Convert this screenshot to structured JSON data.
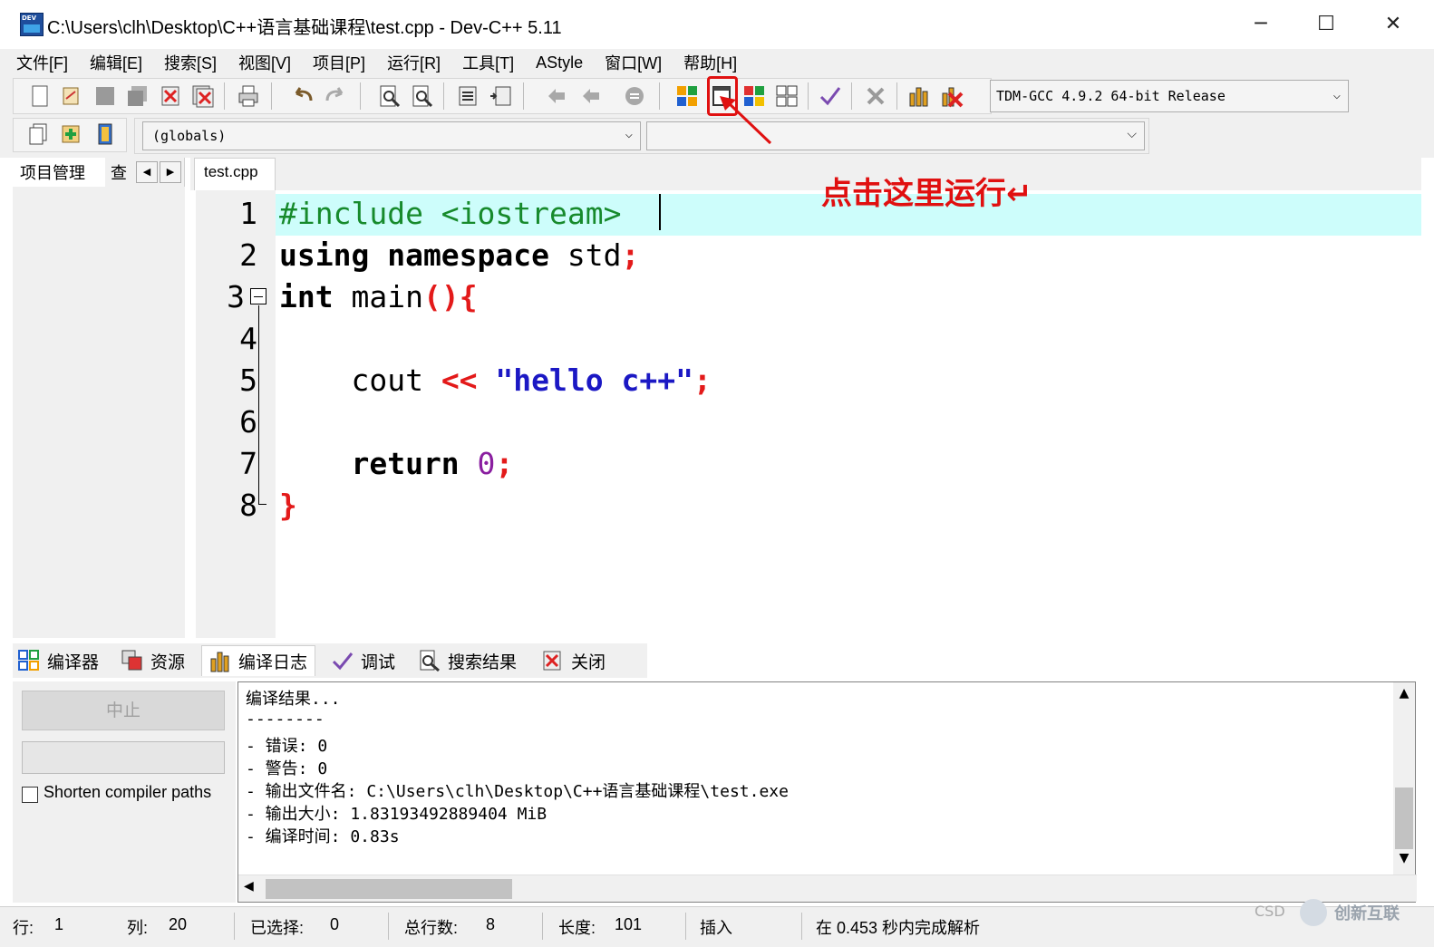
{
  "window": {
    "title": "C:\\Users\\clh\\Desktop\\C++语言基础课程\\test.cpp - Dev-C++ 5.11",
    "minimize_glyph": "─",
    "maximize_glyph": "☐",
    "close_glyph": "✕"
  },
  "menu": [
    "文件[F]",
    "编辑[E]",
    "搜索[S]",
    "视图[V]",
    "项目[P]",
    "运行[R]",
    "工具[T]",
    "AStyle",
    "窗口[W]",
    "帮助[H]"
  ],
  "toolbar": {
    "compiler": "TDM-GCC 4.9.2 64-bit Release",
    "class_scope": "(globals)",
    "members": ""
  },
  "left_panel": {
    "tab_project": "项目管理",
    "tab_view": "查看"
  },
  "editor": {
    "file_tab": "test.cpp",
    "line_numbers": [
      "1",
      "2",
      "3",
      "4",
      "5",
      "6",
      "7",
      "8"
    ],
    "lines": [
      [
        {
          "t": "#include <iostream>",
          "c": "pre"
        }
      ],
      [
        {
          "t": "using namespace",
          "c": "kw"
        },
        {
          "t": " std",
          "c": "id"
        },
        {
          "t": ";",
          "c": "sym"
        }
      ],
      [
        {
          "t": "int",
          "c": "kw"
        },
        {
          "t": " main",
          "c": "id"
        },
        {
          "t": "(){",
          "c": "sym"
        }
      ],
      [],
      [
        {
          "t": "    cout ",
          "c": "id"
        },
        {
          "t": "<<",
          "c": "sym"
        },
        {
          "t": " \"hello c++\"",
          "c": "str"
        },
        {
          "t": ";",
          "c": "sym"
        }
      ],
      [],
      [
        {
          "t": "    return",
          "c": "kw"
        },
        {
          "t": " 0",
          "c": "num"
        },
        {
          "t": ";",
          "c": "sym"
        }
      ],
      [
        {
          "t": "}",
          "c": "sym"
        }
      ]
    ]
  },
  "annotation": {
    "text": "点击这里运行↵"
  },
  "bottom": {
    "tabs": [
      "编译器",
      "资源",
      "编译日志",
      "调试",
      "搜索结果",
      "关闭"
    ],
    "stop_button": "中止",
    "shorten_label": "Shorten compiler paths",
    "log": [
      "编译结果...",
      "--------",
      "- 错误: 0",
      "- 警告: 0",
      "- 输出文件名: C:\\Users\\clh\\Desktop\\C++语言基础课程\\test.exe",
      "- 输出大小: 1.83193492889404 MiB",
      "- 编译时间: 0.83s"
    ]
  },
  "status": {
    "row_label": "行:",
    "row_value": "1",
    "col_label": "列:",
    "col_value": "20",
    "sel_label": "已选择:",
    "sel_value": "0",
    "total_label": "总行数:",
    "total_value": "8",
    "len_label": "长度:",
    "len_value": "101",
    "mode": "插入",
    "parse_msg": "在 0.453 秒内完成解析"
  },
  "watermark": {
    "text": "创新互联",
    "prefix": "CSD"
  },
  "colors": {
    "current_line": "#cdfdfb",
    "annotation_red": "#e01010",
    "preprocessor": "#178a2c",
    "string": "#1b18c4",
    "symbol": "#e31a1a",
    "number": "#8a1fa0"
  }
}
